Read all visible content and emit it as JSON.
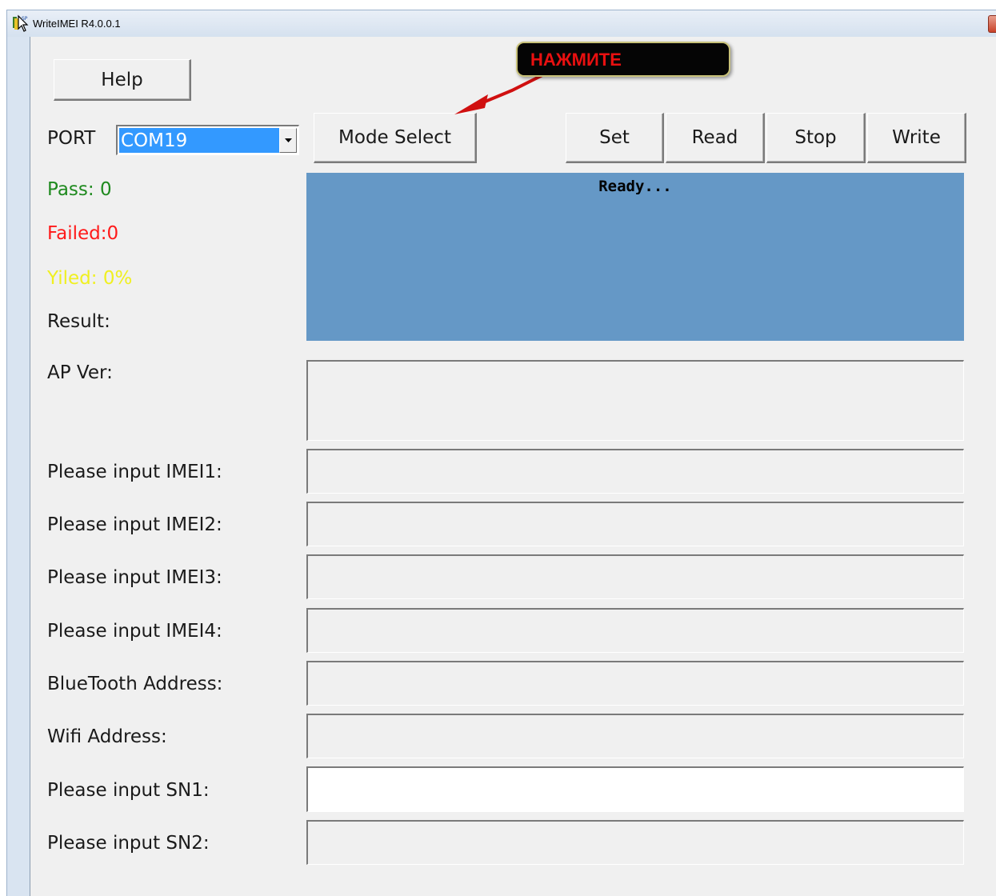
{
  "window": {
    "title": "WriteIMEI R4.0.0.1"
  },
  "toolbar": {
    "help_label": "Help",
    "port_label": "PORT",
    "port_value": "COM19",
    "mode_select_label": "Mode Select",
    "set_label": "Set",
    "read_label": "Read",
    "stop_label": "Stop",
    "write_label": "Write"
  },
  "stats": {
    "pass": "Pass:  0",
    "failed": "Failed:0",
    "yield": "Yiled: 0%",
    "result": "Result:"
  },
  "status": {
    "text": "Ready..."
  },
  "fields": [
    {
      "label": "AP Ver:",
      "value": ""
    },
    {
      "label": "Please input IMEI1:",
      "value": ""
    },
    {
      "label": "Please input IMEI2:",
      "value": ""
    },
    {
      "label": "Please input IMEI3:",
      "value": ""
    },
    {
      "label": "Please input IMEI4:",
      "value": ""
    },
    {
      "label": "BlueTooth Address:",
      "value": ""
    },
    {
      "label": "Wifi Address:",
      "value": ""
    },
    {
      "label": "Please input SN1:",
      "value": ""
    },
    {
      "label": "Please input SN2:",
      "value": ""
    }
  ],
  "annotation": {
    "callout_text": "НАЖМИТЕ"
  },
  "colors": {
    "pass": "#1f8a1f",
    "failed": "#ff1a1a",
    "yield": "#f0f020",
    "status_panel": "#6598c6",
    "callout_text": "#e81010",
    "arrow": "#d01010"
  }
}
